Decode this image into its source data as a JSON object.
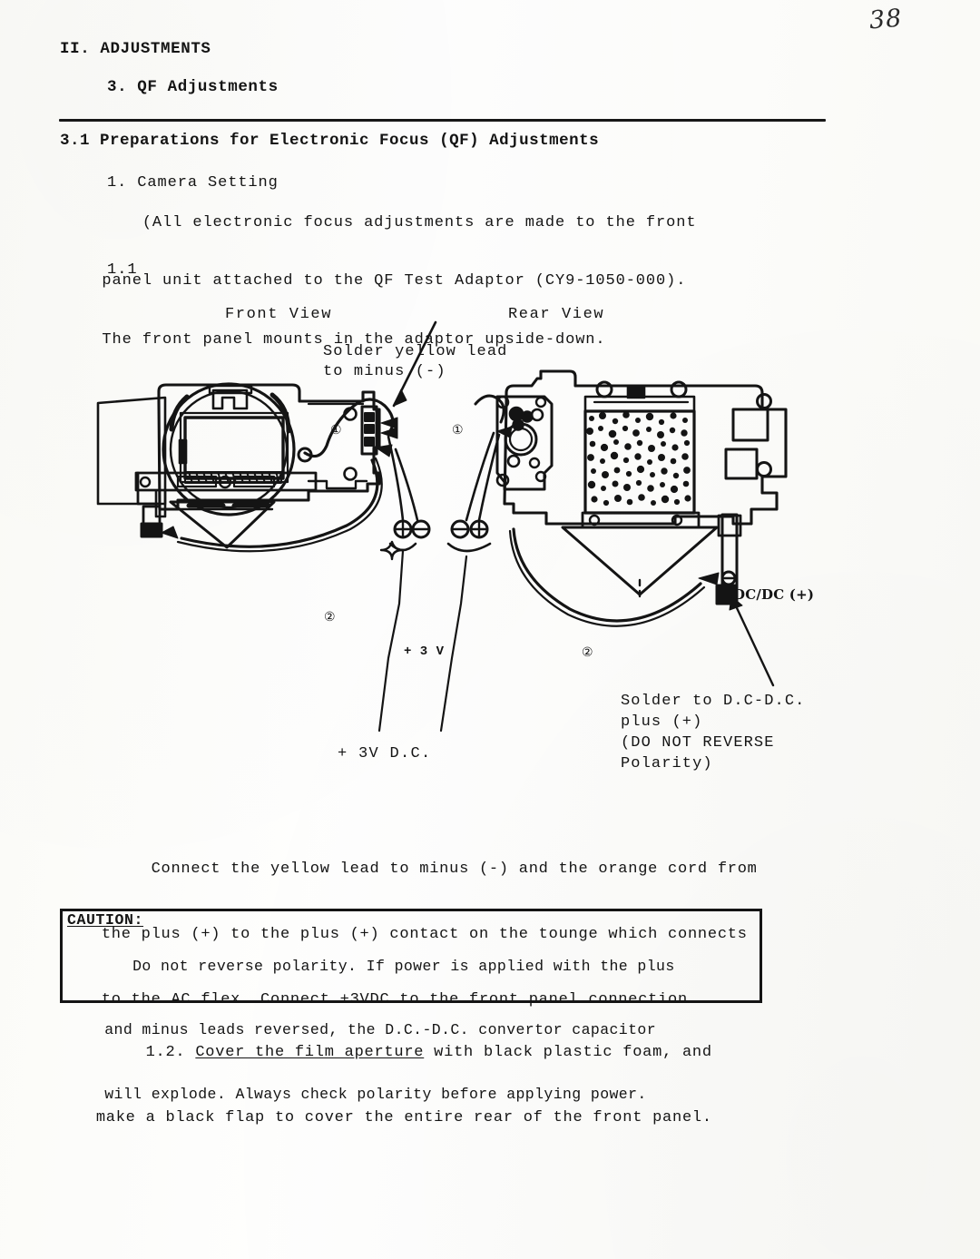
{
  "page": {
    "number": "38",
    "chapter_heading": "II.  ADJUSTMENTS",
    "section_heading": "3.  QF Adjustments",
    "subsection_heading": "3.1 Preparations for Electronic Focus (QF) Adjustments"
  },
  "item_1": {
    "title": "1. Camera Setting",
    "line1": "    (All electronic focus adjustments are made to the front",
    "line2": "panel unit attached to the QF Test Adaptor (CY9-1050-000).",
    "line3": "The front panel mounts in the adaptor upside-down.",
    "label_1_1": "1.1"
  },
  "figure": {
    "caption_front_view": "Front View",
    "caption_rear_view": "Rear View",
    "solder_yellow_lead": "Solder yellow lead\nto minus (-)",
    "plus_3v_dc": "+ 3V D.C.",
    "plus_3v_small": "+ 3 V",
    "solder_to_dc": "Solder to D.C-D.C.\nplus (+)\n(DO NOT REVERSE\nPolarity)",
    "dc_dc_plus": "DC/DC (+)",
    "callout_1_front": "①",
    "callout_1_rear": "①",
    "callout_2_front": "②",
    "callout_2_rear": "②",
    "terminal_minus": "−",
    "terminal_plus": "+",
    "front_pair_left_symbol": "⊕",
    "front_pair_right_symbol": "⊖",
    "rear_pair_left_symbol": "⊖",
    "rear_pair_right_symbol": "⊕"
  },
  "connect_paragraph": {
    "line1": "     Connect the yellow lead to minus (-) and the orange cord from",
    "line2": "the plus (+) to the plus (+) contact on the tounge which connects",
    "line3": "to the AC flex. Connect +3VDC to the front panel connection."
  },
  "caution": {
    "title": "CAUTION:",
    "line1": "   Do not reverse polarity. If power is applied with the plus",
    "line2": "and minus leads reversed, the D.C.-D.C. convertor capacitor",
    "line3": "will explode. Always check polarity before applying power."
  },
  "item_1_2": {
    "prefix": "     1.2. ",
    "underlined": "Cover the film aperture",
    "rest": " with black plastic foam, and",
    "line2": "make a black flap to cover the entire rear of the front panel."
  },
  "colors": {
    "ink": "#141414",
    "paper": "#fdfdfc"
  }
}
